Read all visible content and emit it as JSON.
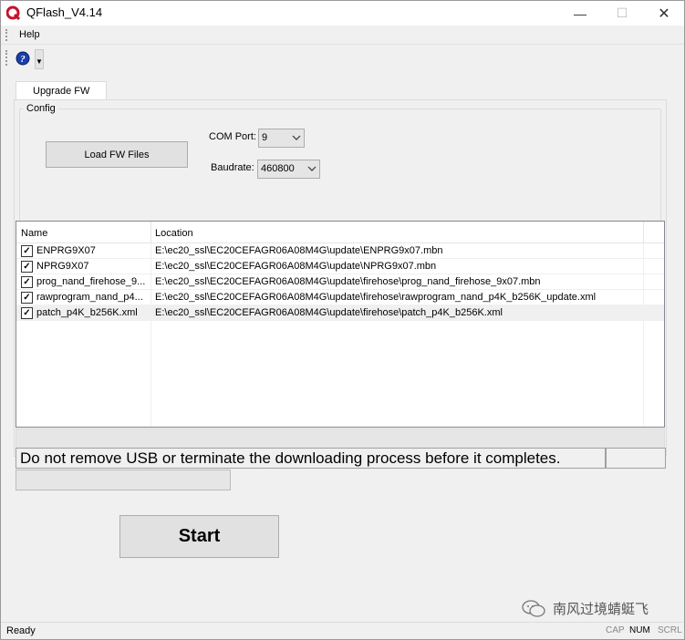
{
  "window": {
    "title": "QFlash_V4.14"
  },
  "menu": {
    "help": "Help"
  },
  "tabs": [
    {
      "label": "Upgrade FW"
    }
  ],
  "config": {
    "group_label": "Config",
    "load_button": "Load FW Files",
    "com_port_label": "COM Port:",
    "com_port_value": "9",
    "baudrate_label": "Baudrate:",
    "baudrate_value": "460800"
  },
  "file_list": {
    "columns": {
      "name": "Name",
      "location": "Location"
    },
    "rows": [
      {
        "checked": true,
        "name": "ENPRG9X07",
        "location": "E:\\ec20_ssl\\EC20CEFAGR06A08M4G\\update\\ENPRG9x07.mbn"
      },
      {
        "checked": true,
        "name": "NPRG9X07",
        "location": "E:\\ec20_ssl\\EC20CEFAGR06A08M4G\\update\\NPRG9x07.mbn"
      },
      {
        "checked": true,
        "name": "prog_nand_firehose_9...",
        "location": "E:\\ec20_ssl\\EC20CEFAGR06A08M4G\\update\\firehose\\prog_nand_firehose_9x07.mbn"
      },
      {
        "checked": true,
        "name": "rawprogram_nand_p4...",
        "location": "E:\\ec20_ssl\\EC20CEFAGR06A08M4G\\update\\firehose\\rawprogram_nand_p4K_b256K_update.xml"
      },
      {
        "checked": true,
        "name": "patch_p4K_b256K.xml",
        "location": "E:\\ec20_ssl\\EC20CEFAGR06A08M4G\\update\\firehose\\patch_p4K_b256K.xml"
      }
    ]
  },
  "message": "Do not remove USB or terminate the downloading process before it completes.",
  "progress": 0,
  "start_button": "Start",
  "watermark": "南风过境蜻蜓飞",
  "status": {
    "text": "Ready",
    "cap": "CAP",
    "num": "NUM",
    "scrl": "SCRL"
  },
  "colors": {
    "accent_red": "#c8102e",
    "help_blue": "#1a3fa8"
  }
}
